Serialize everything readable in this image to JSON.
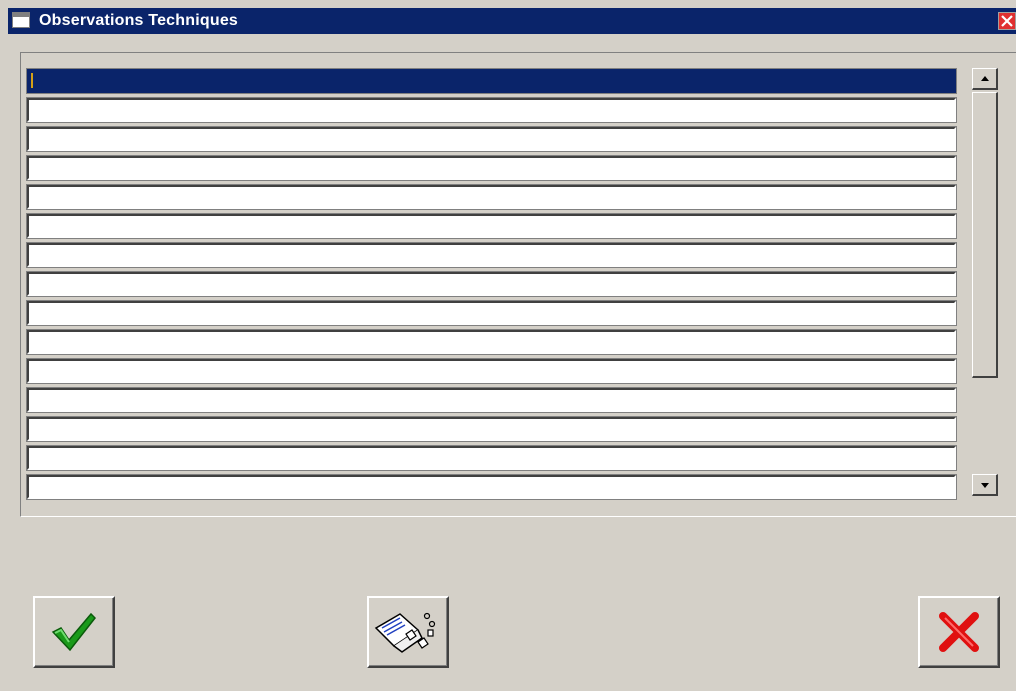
{
  "window": {
    "title": "Observations Techniques"
  },
  "list": {
    "row_count": 15,
    "selected_index": 0,
    "selection_color": "#0a246a"
  },
  "buttons": {
    "ok": {
      "icon": "green-checkmark-icon"
    },
    "middle": {
      "icon": "shredder-notes-icon"
    },
    "cancel": {
      "icon": "red-x-icon"
    }
  },
  "colors": {
    "titlebar": "#0a246a",
    "face": "#d4d0c8"
  }
}
